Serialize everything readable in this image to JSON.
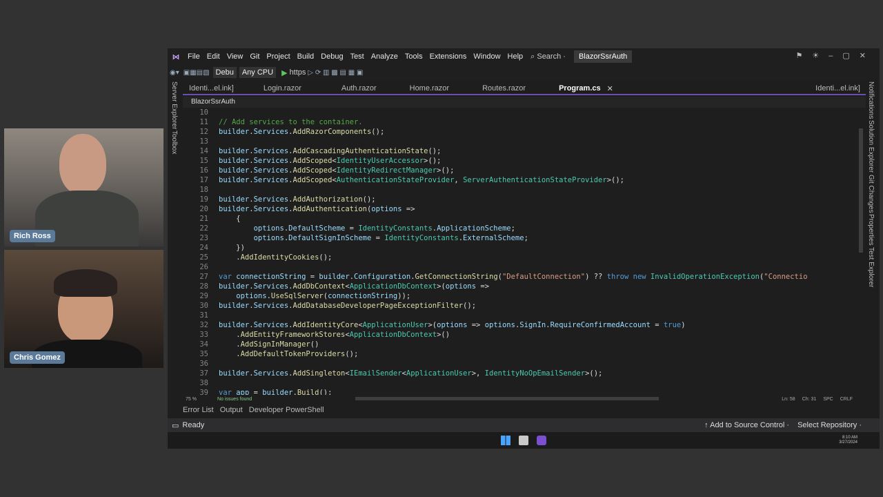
{
  "menu": [
    "File",
    "Edit",
    "View",
    "Git",
    "Project",
    "Build",
    "Debug",
    "Test",
    "Analyze",
    "Tools",
    "Extensions",
    "Window",
    "Help"
  ],
  "search_label": "⌕ Search ·",
  "solution_title": "BlazorSsrAuth",
  "toolbar": {
    "config": "Debu",
    "platform": "Any CPU",
    "run": "https"
  },
  "left_panels": [
    "Server Explorer",
    "Toolbox"
  ],
  "right_panels": [
    "Notifications",
    "Solution Explorer",
    "Git Changes",
    "Properties",
    "Test Explorer"
  ],
  "tabs": [
    "Identi...el.ink]",
    "Login.razor",
    "Auth.razor",
    "Home.razor",
    "Routes.razor",
    "Program.cs"
  ],
  "tab_right": "Identi...el.ink]",
  "nav_project": "BlazorSsrAuth",
  "code_lines": [
    {
      "n": "10",
      "html": ""
    },
    {
      "n": "11",
      "html": "<span class='c'>// Add services to the container.</span>"
    },
    {
      "n": "12",
      "html": "<span class='p'>builder</span>.<span class='p'>Services</span>.<span class='m'>AddRazorComponents</span>();"
    },
    {
      "n": "13",
      "html": ""
    },
    {
      "n": "14",
      "html": "<span class='p'>builder</span>.<span class='p'>Services</span>.<span class='m'>AddCascadingAuthenticationState</span>();"
    },
    {
      "n": "15",
      "html": "<span class='p'>builder</span>.<span class='p'>Services</span>.<span class='m'>AddScoped</span>&lt;<span class='t'>IdentityUserAccessor</span>&gt;();"
    },
    {
      "n": "16",
      "html": "<span class='p'>builder</span>.<span class='p'>Services</span>.<span class='m'>AddScoped</span>&lt;<span class='t'>IdentityRedirectManager</span>&gt;();"
    },
    {
      "n": "17",
      "html": "<span class='p'>builder</span>.<span class='p'>Services</span>.<span class='m'>AddScoped</span>&lt;<span class='t'>AuthenticationStateProvider</span>, <span class='t'>ServerAuthenticationStateProvider</span>&gt;();"
    },
    {
      "n": "18",
      "html": ""
    },
    {
      "n": "19",
      "html": "<span class='p'>builder</span>.<span class='p'>Services</span>.<span class='m'>AddAuthorization</span>();"
    },
    {
      "n": "20",
      "html": "<span class='p'>builder</span>.<span class='p'>Services</span>.<span class='m'>AddAuthentication</span>(<span class='p'>options</span> =&gt;"
    },
    {
      "n": "21",
      "html": "    {"
    },
    {
      "n": "22",
      "html": "        <span class='p'>options</span>.<span class='p'>DefaultScheme</span> = <span class='t'>IdentityConstants</span>.<span class='p'>ApplicationScheme</span>;"
    },
    {
      "n": "23",
      "html": "        <span class='p'>options</span>.<span class='p'>DefaultSignInScheme</span> = <span class='t'>IdentityConstants</span>.<span class='p'>ExternalScheme</span>;"
    },
    {
      "n": "24",
      "html": "    })"
    },
    {
      "n": "25",
      "html": "    .<span class='m'>AddIdentityCookies</span>();"
    },
    {
      "n": "26",
      "html": ""
    },
    {
      "n": "27",
      "html": "<span class='k'>var</span> <span class='p'>connectionString</span> = <span class='p'>builder</span>.<span class='p'>Configuration</span>.<span class='m'>GetConnectionString</span>(<span class='s'>\"DefaultConnection\"</span>) ?? <span class='k'>throw</span> <span class='k'>new</span> <span class='t'>InvalidOperationException</span>(<span class='s'>\"Connectio</span>"
    },
    {
      "n": "28",
      "html": "<span class='p'>builder</span>.<span class='p'>Services</span>.<span class='m'>AddDbContext</span>&lt;<span class='t'>ApplicationDbContext</span>&gt;(<span class='p'>options</span> =&gt;"
    },
    {
      "n": "29",
      "html": "    <span class='p'>options</span>.<span class='m'>UseSqlServer</span>(<span class='p'>connectionString</span>));"
    },
    {
      "n": "30",
      "html": "<span class='p'>builder</span>.<span class='p'>Services</span>.<span class='m'>AddDatabaseDeveloperPageExceptionFilter</span>();"
    },
    {
      "n": "31",
      "html": ""
    },
    {
      "n": "32",
      "html": "<span class='p'>builder</span>.<span class='p'>Services</span>.<span class='m'>AddIdentityCore</span>&lt;<span class='t'>ApplicationUser</span>&gt;(<span class='p'>options</span> =&gt; <span class='p'>options</span>.<span class='p'>SignIn</span>.<span class='p'>RequireConfirmedAccount</span> = <span class='k'>true</span>)"
    },
    {
      "n": "33",
      "html": "    .<span class='m'>AddEntityFrameworkStores</span>&lt;<span class='t'>ApplicationDbContext</span>&gt;()"
    },
    {
      "n": "34",
      "html": "    .<span class='m'>AddSignInManager</span>()"
    },
    {
      "n": "35",
      "html": "    .<span class='m'>AddDefaultTokenProviders</span>();"
    },
    {
      "n": "36",
      "html": ""
    },
    {
      "n": "37",
      "html": "<span class='p'>builder</span>.<span class='p'>Services</span>.<span class='m'>AddSingleton</span>&lt;<span class='t'>IEmailSender</span>&lt;<span class='t'>ApplicationUser</span>&gt;, <span class='t'>IdentityNoOpEmailSender</span>&gt;();"
    },
    {
      "n": "38",
      "html": ""
    },
    {
      "n": "39",
      "html": "<span class='k'>var</span> <span class='p'>app</span> = <span class='p'>builder</span>.<span class='m'>Build</span>();"
    }
  ],
  "editor_status": {
    "zoom": "75 %",
    "issues": "No issues found",
    "pos": "Ln: 58",
    "col": "Ch: 31",
    "enc": "SPC",
    "eol": "CRLF"
  },
  "bottom_tabs": [
    "Error List",
    "Output",
    "Developer PowerShell"
  ],
  "status": {
    "ready": "Ready",
    "source_control": "↑ Add to Source Control ·",
    "repo": "Select Repository ·"
  },
  "clock": {
    "time": "8:10 AM",
    "date": "3/27/2024"
  },
  "participants": [
    "Rich Ross",
    "Chris Gomez"
  ]
}
